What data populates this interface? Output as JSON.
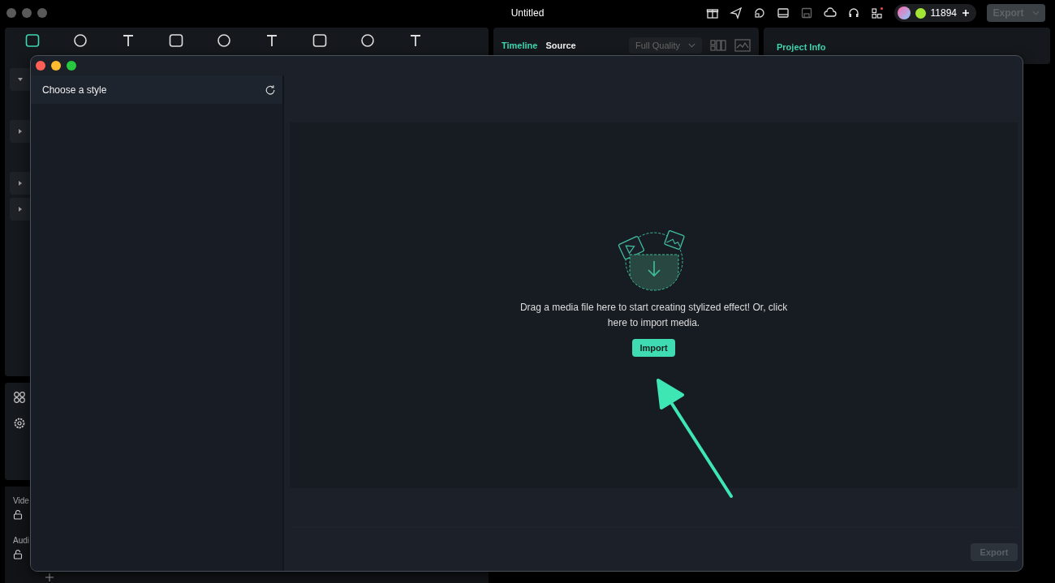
{
  "app": {
    "title": "Untitled",
    "points": "11894",
    "export": {
      "label": "Export",
      "disabled": true
    }
  },
  "toolbar": [
    {
      "selected": true
    },
    {
      "selected": false
    },
    {
      "selected": false
    },
    {
      "selected": false
    },
    {
      "selected": false
    },
    {
      "selected": false
    },
    {
      "selected": false
    },
    {
      "selected": false
    },
    {
      "selected": false
    }
  ],
  "library": [
    {
      "kind": "group",
      "expanded": true
    },
    {
      "kind": "item"
    },
    {
      "kind": "group",
      "expanded": false
    },
    {
      "kind": "item"
    },
    {
      "kind": "group",
      "expanded": false
    },
    {
      "kind": "group",
      "expanded": false
    },
    {
      "kind": "item"
    }
  ],
  "tracks": [
    {
      "label": "Vide"
    },
    {
      "label": "Audi"
    }
  ],
  "preview": {
    "tabs": [
      {
        "label": "Timeline",
        "selected": true
      },
      {
        "label": "Source",
        "selected": false
      }
    ],
    "quality": "Full Quality"
  },
  "info": {
    "title": "Project Info"
  },
  "dialog": {
    "style_header": "Choose a style",
    "message": "Drag a media file here to start creating stylized effect! Or, click here to import media.",
    "import": "Import",
    "export": {
      "label": "Export",
      "disabled": true
    }
  }
}
